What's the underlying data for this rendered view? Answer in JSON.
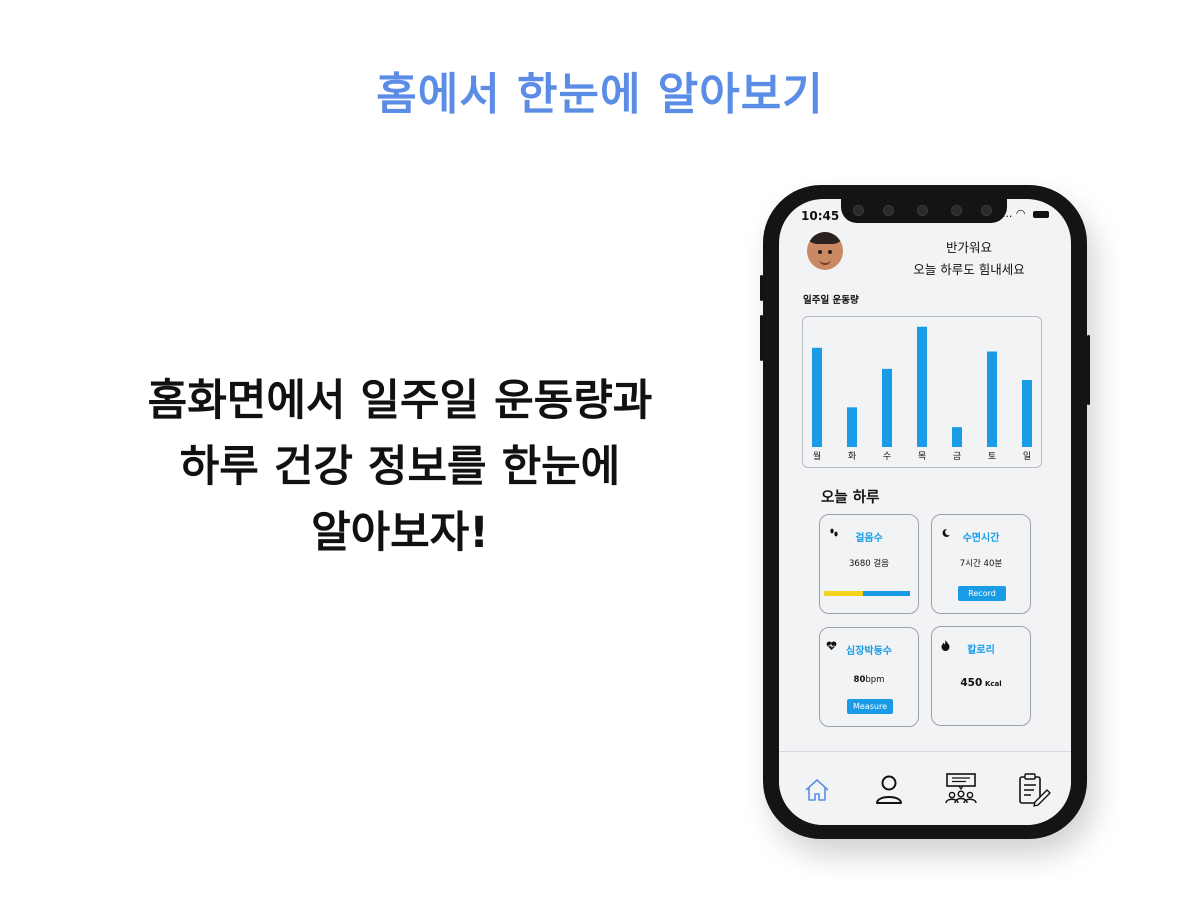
{
  "page": {
    "title": "홈에서 한눈에 알아보기",
    "headline": [
      "홈화면에서 일주일 운동량과",
      "하루 건강 정보를 한눈에",
      "알아보자!"
    ]
  },
  "phone": {
    "status_time": "10:45",
    "status_dots": "....",
    "greeting_line1": "반가워요",
    "greeting_line2": "오늘 하루도 힘내세요",
    "week_label": "일주일 운동량",
    "today_label": "오늘 하루",
    "cards": {
      "steps": {
        "title": "걸음수",
        "value": "3680 걸음",
        "icon": "footprints-icon",
        "progress": 0.45
      },
      "sleep": {
        "title": "수면시간",
        "value": "7시간 40분",
        "button": "Record",
        "icon": "moon-icon"
      },
      "heart": {
        "title": "심장박동수",
        "value_num": "80",
        "value_unit": "bpm",
        "button": "Measure",
        "icon": "heart-pulse-icon"
      },
      "calorie": {
        "title": "칼로리",
        "value_num": "450",
        "value_unit": "Kcal",
        "icon": "flame-icon"
      }
    },
    "tabs": [
      "home-icon",
      "user-icon",
      "community-icon",
      "clipboard-edit-icon"
    ]
  },
  "colors": {
    "accent": "#1a9be6",
    "title": "#5b8de6",
    "progress_yellow": "#f2d21a"
  },
  "chart_data": {
    "type": "bar",
    "categories": [
      "월",
      "화",
      "수",
      "목",
      "금",
      "토",
      "일"
    ],
    "values": [
      80,
      32,
      63,
      97,
      16,
      77,
      54
    ],
    "ylim": [
      0,
      100
    ],
    "grid": false
  }
}
